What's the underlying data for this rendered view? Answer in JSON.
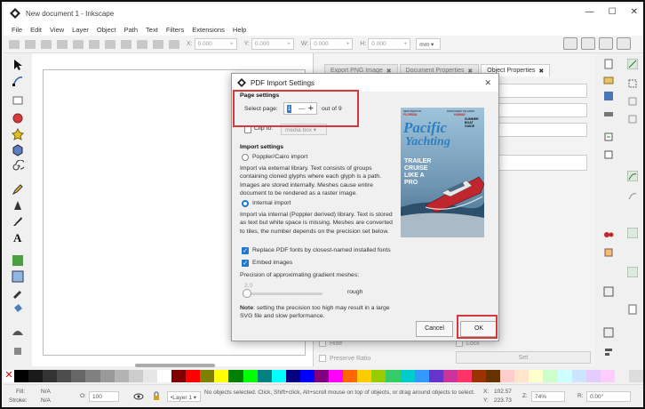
{
  "window": {
    "title": "New document 1 - Inkscape",
    "minimize_glyph": "—",
    "maximize_glyph": "☐",
    "close_glyph": "✕"
  },
  "menu": [
    "File",
    "Edit",
    "View",
    "Layer",
    "Object",
    "Path",
    "Text",
    "Filters",
    "Extensions",
    "Help"
  ],
  "toolbar": {
    "x_label": "X:",
    "y_label": "Y:",
    "w_label": "W:",
    "h_label": "H:",
    "x_value": "0.000",
    "y_value": "0.000",
    "w_value": "0.000",
    "h_value": "0.000",
    "units": "mm"
  },
  "panel": {
    "tabs": [
      {
        "label": "Export PNG Image",
        "close": "✖"
      },
      {
        "label": "Document Properties",
        "close": "✖"
      },
      {
        "label": "Object Properties",
        "close": "✖"
      }
    ],
    "hide_label": "Hide",
    "lock_label": "Lock",
    "preserve_ratio_label": "Preserve Ratio",
    "set_button": "Set"
  },
  "dialog": {
    "title": "PDF Import Settings",
    "close_glyph": "✕",
    "page_settings_heading": "Page settings",
    "select_page_label": "Select page:",
    "page_value": "1",
    "page_out_of": "out of 9",
    "clip_to_label": "Clip to:",
    "clip_to_value": "media box",
    "import_settings_heading": "Import settings",
    "poppler_cairo_label": "Poppler/Cairo import",
    "poppler_cairo_desc": "Import via external library. Text consists of groups containing cloned glyphs where each glyph is a path. Images are stored internally. Meshes cause entire document to be rendered as a raster image.",
    "internal_import_label": "Internal import",
    "internal_import_desc": "Import via internal (Poppler derived) library. Text is stored as text but white space is missing. Meshes are converted to tiles, the number depends on the precision set below.",
    "replace_fonts_label": "Replace PDF fonts by closest-named installed fonts",
    "embed_images_label": "Embed images",
    "precision_label": "Precision of approximating gradient meshes:",
    "precision_value": "2.0",
    "precision_level_text": "rough",
    "note_bold": "Note",
    "note_text": ": setting the precision too high may result in a large SVG file and slow performance.",
    "cancel_label": "Cancel",
    "ok_label": "OK"
  },
  "cover": {
    "top_left_1": "DESTINATION",
    "top_left_2": "FLORIDA",
    "top_right_1": "DISCOVERY ISLANDS",
    "top_right_2": "HAWAII",
    "title_line_1": "Pacific",
    "title_line_2": "Yachting",
    "side_line_1": "SUMMER",
    "side_line_2": "BOAT",
    "side_line_3": "GUIDE",
    "headline_1": "TRAILER",
    "headline_2": "CRUISE",
    "headline_3": "LIKE A",
    "headline_4": "PRO"
  },
  "status": {
    "fill_label": "Fill:",
    "fill_value": "N/A",
    "stroke_label": "Stroke:",
    "stroke_value": "N/A",
    "opacity_label": "O:",
    "opacity_value": "100",
    "layer_name": "•Layer 1",
    "message": "No objects selected. Click, Shift+click, Alt+scroll mouse on top of objects, or drag around objects to select.",
    "x_label": "X:",
    "x_value": "102.57",
    "y_label": "Y:",
    "y_value": "223.73",
    "zoom_label": "Z:",
    "zoom_value": "74%",
    "rotate_label": "R:",
    "rotate_value": "0.00°"
  },
  "colors": {
    "highlight_box": "#d6393a",
    "accent_blue": "#1e78d0",
    "cover_blue": "#2f7fc0",
    "cover_red": "#c0262d"
  }
}
